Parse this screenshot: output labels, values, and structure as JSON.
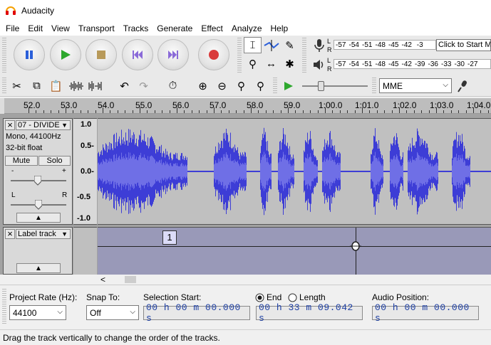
{
  "window": {
    "title": "Audacity"
  },
  "menu": [
    "File",
    "Edit",
    "View",
    "Transport",
    "Tracks",
    "Generate",
    "Effect",
    "Analyze",
    "Help"
  ],
  "meters": {
    "record_scale": [
      "-57",
      "-54",
      "-51",
      "-48",
      "-45",
      "-42",
      "-3"
    ],
    "record_tooltip": "Click to Start Mo",
    "play_scale": [
      "-57",
      "-54",
      "-51",
      "-48",
      "-45",
      "-42",
      "-39",
      "-36",
      "-33",
      "-30",
      "-27"
    ],
    "record_channels": [
      "L",
      "R"
    ],
    "play_channels": [
      "L",
      "R"
    ]
  },
  "device": {
    "host": "MME"
  },
  "ruler": {
    "ticks": [
      "52.0",
      "53.0",
      "54.0",
      "55.0",
      "56.0",
      "57.0",
      "58.0",
      "59.0",
      "1:00.0",
      "1:01.0",
      "1:02.0",
      "1:03.0",
      "1:04.0"
    ]
  },
  "audio_track": {
    "name": "07 - DIVIDE",
    "info_line1": "Mono, 44100Hz",
    "info_line2": "32-bit float",
    "mute_label": "Mute",
    "solo_label": "Solo",
    "gain_minus": "-",
    "gain_plus": "+",
    "pan_left": "L",
    "pan_right": "R",
    "close_glyph": "×",
    "collapse_glyph": "▲",
    "scale": [
      "1.0",
      "0.5-",
      "0.0-",
      "-0.5",
      "-1.0"
    ]
  },
  "label_track": {
    "name": "Label track",
    "close_glyph": "×",
    "collapse_glyph": "▲",
    "label_text": "1"
  },
  "selection_bar": {
    "project_rate_label": "Project Rate (Hz):",
    "project_rate_value": "44100",
    "snap_to_label": "Snap To:",
    "snap_to_value": "Off",
    "selection_start_label": "Selection Start:",
    "selection_start_value": "00 h 00 m 00.000 s",
    "end_label": "End",
    "length_label": "Length",
    "end_value": "00 h 33 m 09.042 s",
    "audio_position_label": "Audio Position:",
    "audio_position_value": "00 h 00 m 00.000 s",
    "end_selected": true
  },
  "status": {
    "text": "Drag the track vertically to change the order of the tracks."
  },
  "scroll": {
    "left_arrow": "<"
  },
  "colors": {
    "wave": "#3d3dd6",
    "wave_rms": "#6f6fe6",
    "track_bg": "#c0c0c0"
  }
}
